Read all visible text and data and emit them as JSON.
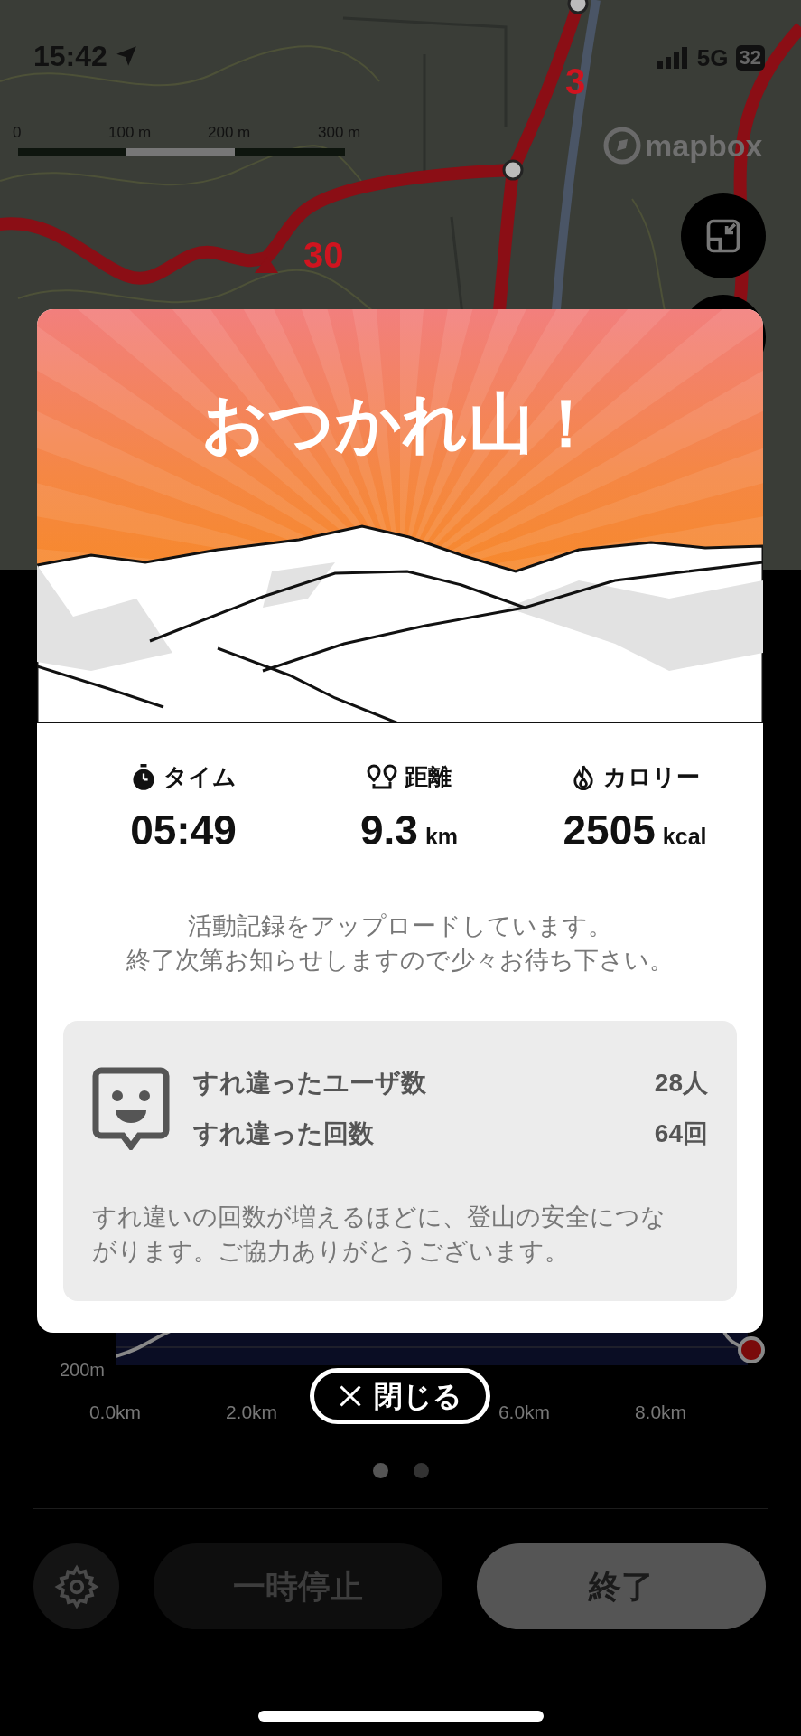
{
  "status_bar": {
    "time": "15:42",
    "network": "5G",
    "battery": "32"
  },
  "map": {
    "scale_labels": [
      "0",
      "100 m",
      "200 m",
      "300 m"
    ],
    "attribution": "mapbox",
    "route_labels": [
      "3",
      "30"
    ]
  },
  "elevation_chart": {
    "y_label": "200m",
    "x_labels": [
      "0.0km",
      "2.0km",
      "6.0km",
      "8.0km"
    ]
  },
  "page_dots": [
    {
      "selected": true
    },
    {
      "selected": false
    }
  ],
  "controls": {
    "pause": "一時停止",
    "finish": "終了"
  },
  "modal": {
    "title": "おつかれ山！",
    "stats": [
      {
        "label": "タイム",
        "value": "05:49"
      },
      {
        "label": "距離",
        "value": "9.3",
        "unit": "km"
      },
      {
        "label": "カロリー",
        "value": "2505",
        "unit": "kcal"
      }
    ],
    "message_lines": [
      "活動記録をアップロードしています。",
      "終了次第お知らせしますので少々お待ち下さい。"
    ],
    "encounters": {
      "rows": [
        {
          "label": "すれ違ったユーザ数",
          "value": "28人"
        },
        {
          "label": "すれ違った回数",
          "value": "64回"
        }
      ],
      "note": "すれ違いの回数が増えるほどに、登山の安全につながります。ご協力ありがとうございます。"
    },
    "close_button": "閉じる"
  }
}
